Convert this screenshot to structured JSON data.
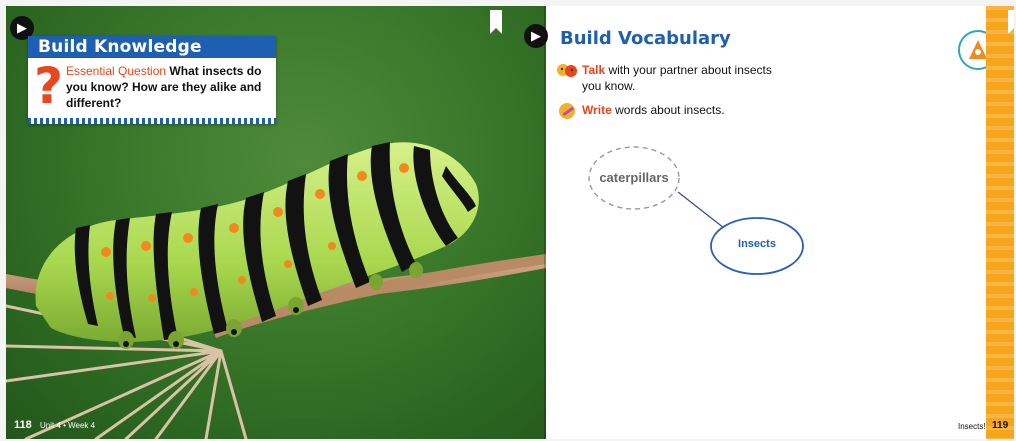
{
  "left_page": {
    "heading": "Build Knowledge",
    "question_label": "Essential Question",
    "question_text": "What insects do you know? How are they alike and different?",
    "question_mark": "?",
    "page_number": "118",
    "footer": "Unit 4 • Week 4"
  },
  "right_page": {
    "heading": "Build Vocabulary",
    "instructions": [
      {
        "highlight": "Talk",
        "text": "with your partner about insects you know.",
        "icon": "talk-icon"
      },
      {
        "highlight": "Write",
        "text": "words about insects.",
        "icon": "write-icon"
      }
    ],
    "web": {
      "center": "Insects",
      "spoke": "caterpillars"
    },
    "page_number": "119",
    "footer": "Insects!"
  },
  "icons": {
    "speaker": "speaker-icon",
    "bookmark": "bookmark-icon",
    "badge": "science-badge-icon"
  },
  "colors": {
    "accent_blue": "#1e5fb1",
    "accent_orange": "#e8461e",
    "side_bar": "#f7a51b"
  }
}
